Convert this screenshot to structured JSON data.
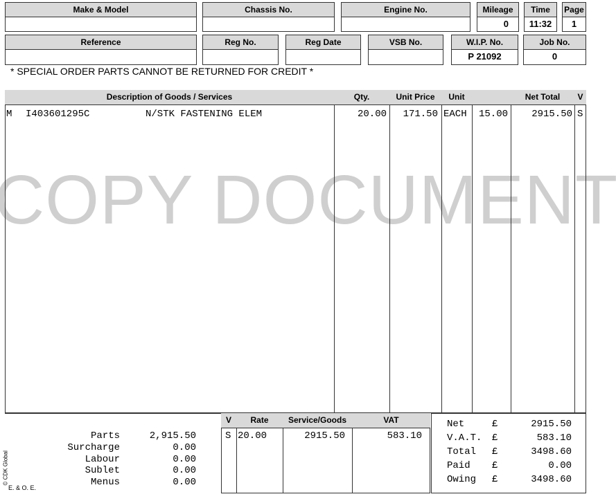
{
  "header_row1": {
    "make_model_label": "Make & Model",
    "chassis_label": "Chassis No.",
    "engine_label": "Engine No.",
    "mileage_label": "Mileage",
    "mileage_value": "0",
    "time_label": "Time",
    "time_value": "11:32",
    "page_label": "Page",
    "page_value": "1"
  },
  "header_row2": {
    "reference_label": "Reference",
    "reg_no_label": "Reg No.",
    "reg_date_label": "Reg Date",
    "vsb_label": "VSB No.",
    "wip_label": "W.I.P. No.",
    "wip_value": "P 21092",
    "job_label": "Job No.",
    "job_value": "0"
  },
  "notice": "* SPECIAL ORDER PARTS CANNOT BE RETURNED FOR CREDIT *",
  "items_table": {
    "headers": {
      "description": "Description of Goods / Services",
      "qty": "Qty.",
      "unit_price": "Unit Price",
      "unit": "Unit",
      "blank": "",
      "net_total": "Net Total",
      "v": "V"
    },
    "rows": [
      {
        "type": "M",
        "part_no": "I403601295C",
        "description": "N/STK FASTENING ELEM",
        "qty": "20.00",
        "unit_price": "171.50",
        "unit": "EACH",
        "extra": "15.00",
        "net_total": "2915.50",
        "v": "S"
      }
    ]
  },
  "watermark": "COPY DOCUMENT",
  "summary": {
    "parts_label": "Parts",
    "parts_value": "2,915.50",
    "surcharge_label": "Surcharge",
    "surcharge_value": "0.00",
    "labour_label": "Labour",
    "labour_value": "0.00",
    "sublet_label": "Sublet",
    "sublet_value": "0.00",
    "menus_label": "Menus",
    "menus_value": "0.00"
  },
  "vat_table": {
    "headers": {
      "v": "V",
      "rate": "Rate",
      "service_goods": "Service/Goods",
      "vat": "VAT"
    },
    "rows": [
      {
        "v": "S",
        "rate": "20.00",
        "service_goods": "2915.50",
        "vat": "583.10"
      }
    ]
  },
  "totals": {
    "net_label": "Net",
    "net_currency": "£",
    "net_value": "2915.50",
    "vat_label": "V.A.T.",
    "vat_currency": "£",
    "vat_value": "583.10",
    "total_label": "Total",
    "total_currency": "£",
    "total_value": "3498.60",
    "paid_label": "Paid",
    "paid_currency": "£",
    "paid_value": "0.00",
    "owing_label": "Owing",
    "owing_currency": "£",
    "owing_value": "3498.60"
  },
  "footer": {
    "copyright": "© CDK Global",
    "eoe": "E. & O. E."
  }
}
